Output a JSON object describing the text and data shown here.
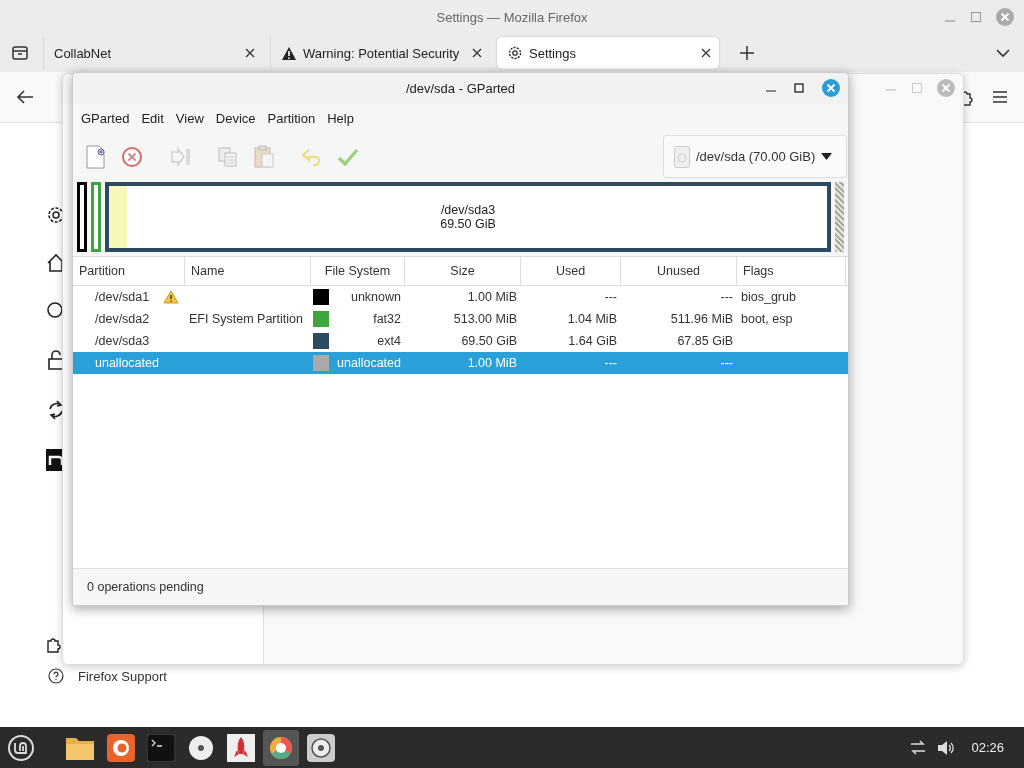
{
  "firefox": {
    "title": "Settings — Mozilla Firefox",
    "tabs": [
      {
        "label": "CollabNet",
        "kind": "plain",
        "selected": false
      },
      {
        "label": "Warning: Potential Security",
        "kind": "warning",
        "selected": false
      },
      {
        "label": "Settings",
        "kind": "settings",
        "selected": true
      }
    ],
    "support_link": "Firefox Support"
  },
  "gparted": {
    "title": "/dev/sda - GParted",
    "menu": [
      "GParted",
      "Edit",
      "View",
      "Device",
      "Partition",
      "Help"
    ],
    "toolbar": [
      {
        "kind": "new"
      },
      {
        "kind": "delete"
      },
      {
        "kind": "resize"
      },
      {
        "kind": "copy"
      },
      {
        "kind": "paste"
      },
      {
        "kind": "undo"
      },
      {
        "kind": "apply"
      }
    ],
    "device": "/dev/sda (70.00 GiB)",
    "disk_map": [
      {
        "kind": "small",
        "color": "#000000"
      },
      {
        "kind": "small",
        "color": "#3fa63f"
      },
      {
        "kind": "main",
        "color": "#2d4a60",
        "label": "/dev/sda3",
        "size": "69.50 GiB",
        "level": 0.025
      },
      {
        "kind": "unallocated",
        "color": "#a9a9a9"
      }
    ],
    "columns": [
      "Partition",
      "Name",
      "File System",
      "Size",
      "Used",
      "Unused",
      "Flags"
    ],
    "rows": [
      {
        "partition": "/dev/sda1",
        "warning": true,
        "name": "",
        "color": "#000000",
        "fs": "unknown",
        "size": "1.00 MiB",
        "used": "---",
        "unused": "---",
        "flags": "bios_grub",
        "selected": false
      },
      {
        "partition": "/dev/sda2",
        "warning": false,
        "name": "EFI System Partition",
        "color": "#3fa63f",
        "fs": "fat32",
        "size": "513.00 MiB",
        "used": "1.04 MiB",
        "unused": "511.96 MiB",
        "flags": "boot, esp",
        "selected": false
      },
      {
        "partition": "/dev/sda3",
        "warning": false,
        "name": "",
        "color": "#2d4a60",
        "fs": "ext4",
        "size": "69.50 GiB",
        "used": "1.64 GiB",
        "unused": "67.85 GiB",
        "flags": "",
        "selected": false
      },
      {
        "partition": "unallocated",
        "warning": false,
        "name": "",
        "color": "#a9a9a9",
        "fs": "unallocated",
        "size": "1.00 MiB",
        "used": "---",
        "unused": "---",
        "flags": "",
        "selected": true
      }
    ],
    "status": "0 operations pending"
  },
  "taskbar": {
    "clock": "02:26"
  }
}
